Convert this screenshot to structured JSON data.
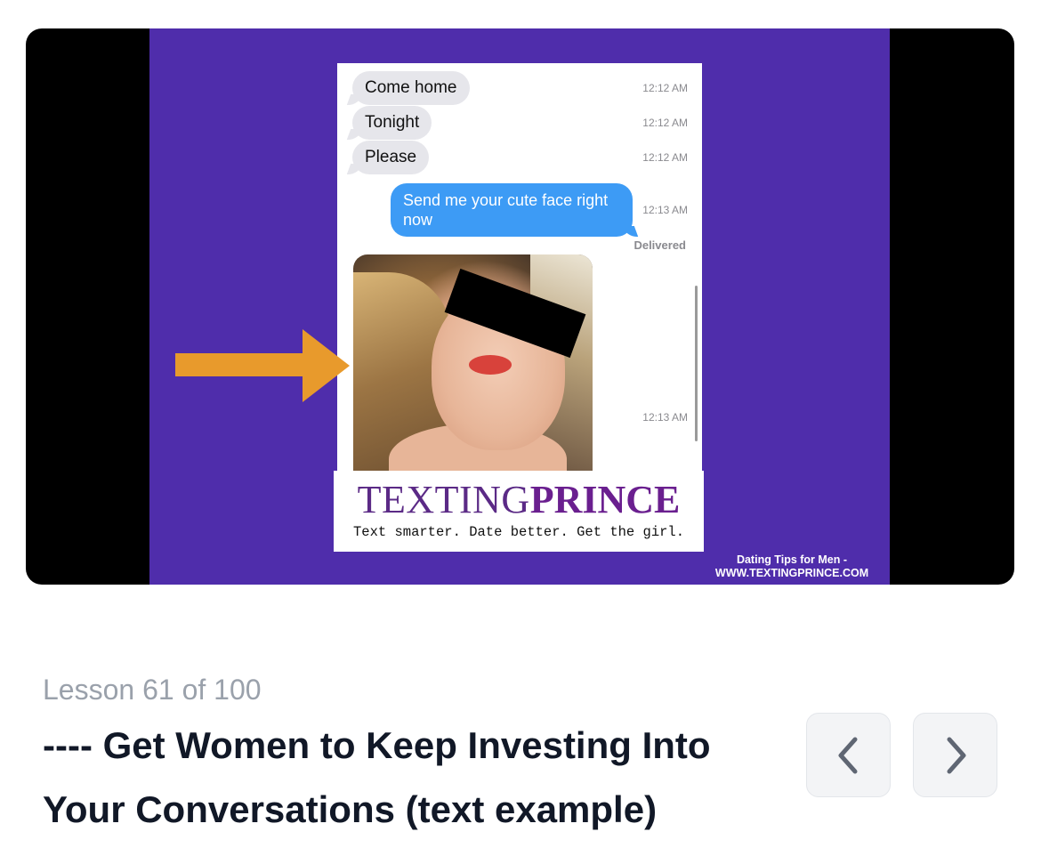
{
  "video": {
    "messages_in": [
      {
        "text": "Come home",
        "time": "12:12 AM"
      },
      {
        "text": "Tonight",
        "time": "12:12 AM"
      },
      {
        "text": "Please",
        "time": "12:12 AM"
      }
    ],
    "message_out": {
      "text": "Send me your cute face right now",
      "time": "12:13 AM"
    },
    "delivered": "Delivered",
    "photo_time": "12:13 AM",
    "brand_part1": "TEXTING",
    "brand_part2": "PRINCE",
    "brand_tagline": "Text smarter. Date better. Get the girl.",
    "watermark_line1": "Dating Tips for Men -",
    "watermark_line2": "WWW.TEXTINGPRINCE.COM",
    "colors": {
      "slide_bg": "#4f2dab",
      "arrow": "#e89a2c",
      "brand": "#6a1f8f",
      "sent_bubble": "#3d9bf5"
    }
  },
  "lesson": {
    "meta": "Lesson 61 of 100",
    "title": "---- Get Women to Keep Investing Into Your Conversations (text example)"
  },
  "nav": {
    "prev_icon": "chevron-left-icon",
    "next_icon": "chevron-right-icon"
  }
}
